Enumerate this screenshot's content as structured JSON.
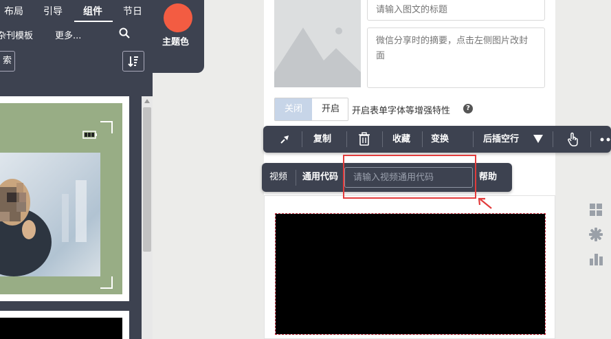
{
  "left_nav": {
    "tabs": [
      {
        "label": "布局",
        "active": false
      },
      {
        "label": "引导",
        "active": false
      },
      {
        "label": "组件",
        "active": true
      },
      {
        "label": "节日",
        "active": false
      }
    ],
    "theme_label": "主题色",
    "theme_color": "#f35c42",
    "subnav": {
      "partial_label": "杂刊模板",
      "more_label": "更多..."
    },
    "search_button_partial": "索"
  },
  "editor": {
    "title_placeholder": "请输入图文的标题",
    "summary_placeholder": "微信分享时的摘要，点击左侧图片改封面",
    "toggle": {
      "off_label": "关闭",
      "on_label": "开启",
      "selected": "关闭"
    },
    "toggle_description": "开启表单字体等增强特性"
  },
  "action_toolbar": {
    "copy": "复制",
    "favorite": "收藏",
    "transform": "变换",
    "insert_after": "后插空行"
  },
  "video_toolbar": {
    "video_label": "视频",
    "code_label": "通用代码",
    "input_placeholder": "请输入视频通用代码",
    "help_label": "帮助"
  },
  "colors": {
    "panel_dark": "#3d4250",
    "highlight_red": "#e23b3b",
    "card_green": "#98ad85"
  }
}
